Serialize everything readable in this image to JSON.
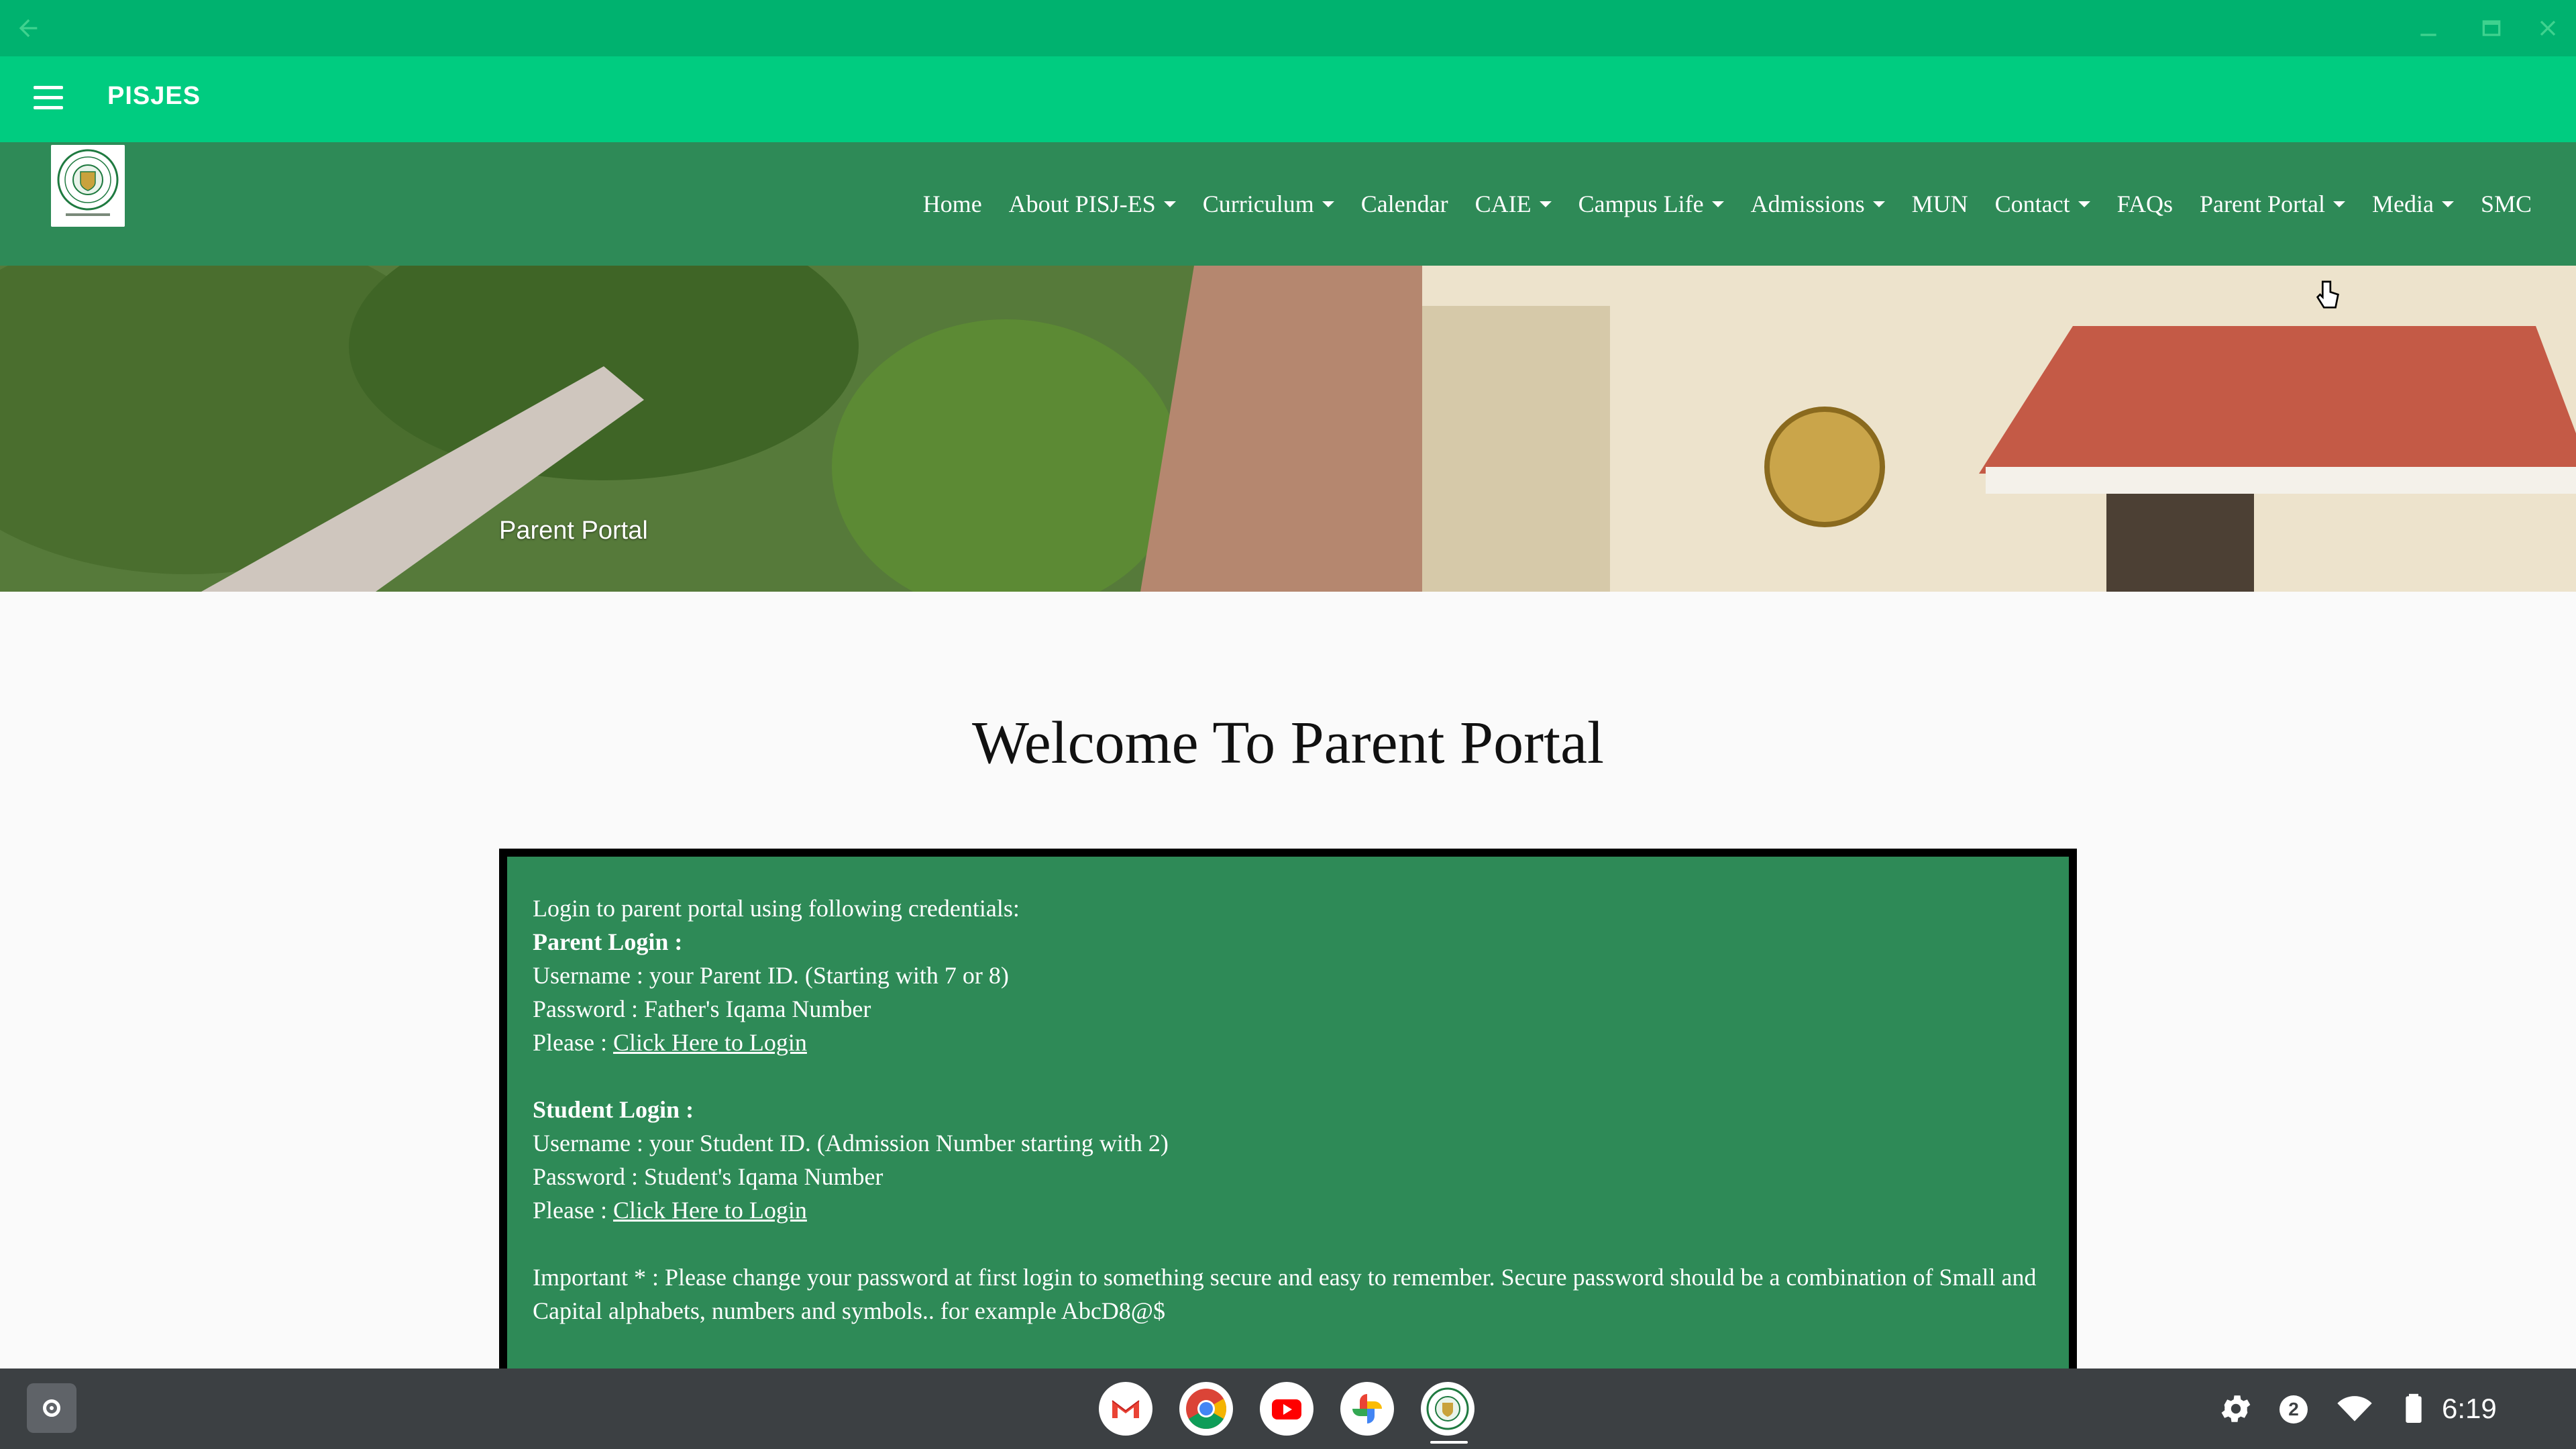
{
  "window": {
    "back_icon": "arrow-left-icon",
    "controls": [
      "minimize-icon",
      "restore-icon",
      "close-icon"
    ]
  },
  "appbar": {
    "title": "PISJES",
    "menu_icon": "hamburger-icon"
  },
  "site_nav": {
    "logo": "school-seal-logo",
    "items": [
      {
        "label": "Home",
        "dropdown": false
      },
      {
        "label": "About PISJ-ES",
        "dropdown": true
      },
      {
        "label": "Curriculum",
        "dropdown": true
      },
      {
        "label": "Calendar",
        "dropdown": false
      },
      {
        "label": "CAIE",
        "dropdown": true
      },
      {
        "label": "Campus Life",
        "dropdown": true
      },
      {
        "label": "Admissions",
        "dropdown": true
      },
      {
        "label": "MUN",
        "dropdown": false
      },
      {
        "label": "Contact",
        "dropdown": true
      },
      {
        "label": "FAQs",
        "dropdown": false
      },
      {
        "label": "Parent Portal",
        "dropdown": true
      },
      {
        "label": "Media",
        "dropdown": true
      },
      {
        "label": "SMC",
        "dropdown": false
      }
    ]
  },
  "banner": {
    "title": "Parent Portal"
  },
  "main": {
    "heading": "Welcome To Parent Portal",
    "intro": "Login to parent portal using following credentials:",
    "parent": {
      "heading": "Parent Login :",
      "username": "Username : your Parent ID. (Starting with 7 or 8)",
      "password": "Password : Father's Iqama Number",
      "please": "Please : ",
      "link": "Click Here to Login"
    },
    "student": {
      "heading": "Student Login :",
      "username": "Username : your Student ID. (Admission Number starting with 2)",
      "password": "Password : Student's Iqama Number",
      "please": "Please : ",
      "link": "Click Here to Login"
    },
    "important": "Important * : Please change your password at first login to something secure and easy to remember. Secure password should be a combination of Small and Capital alphabets, numbers and symbols.. for example AbcD8@$"
  },
  "shelf": {
    "apps": [
      "gmail-icon",
      "chrome-icon",
      "youtube-icon",
      "photos-icon",
      "pisjes-app-icon"
    ],
    "notification_count": "2",
    "time": "6:19"
  },
  "colors": {
    "titlebar": "#00b26f",
    "appbar": "#00cc80",
    "site_nav": "#2e8a57",
    "infobox": "#2e8a57",
    "shelf": "#3c4043"
  }
}
